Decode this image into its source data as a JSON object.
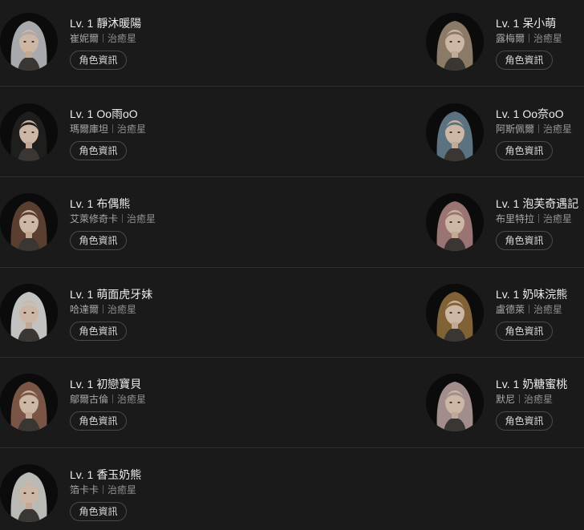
{
  "button_label": "角色資訊",
  "colors": {
    "background": "#1a1a1b",
    "divider": "#2e2e30",
    "title": "#ececec",
    "subtitle": "#a8a8a8"
  },
  "characters": [
    {
      "level": "Lv. 1",
      "name": "靜沐暖陽",
      "char": "崔妮爾",
      "planet": "治癒星",
      "hair": "#a7a9ad"
    },
    {
      "level": "Lv. 1",
      "name": "呆小萌",
      "char": "露梅爾",
      "planet": "治癒星",
      "hair": "#8b7a66"
    },
    {
      "level": "Lv. 1",
      "name": "Oo雨oO",
      "char": "瑪爾庫坦",
      "planet": "治癒星",
      "hair": "#1e1e1c"
    },
    {
      "level": "Lv. 1",
      "name": "Oo奈oO",
      "char": "阿斯佩爾",
      "planet": "治癒星",
      "hair": "#5b7280"
    },
    {
      "level": "Lv. 1",
      "name": "布偶熊",
      "char": "艾萊修奇卡",
      "planet": "治癒星",
      "hair": "#5a3e30"
    },
    {
      "level": "Lv. 1",
      "name": "泡芙奇遇記",
      "char": "布里特拉",
      "planet": "治癒星",
      "hair": "#9a7472"
    },
    {
      "level": "Lv. 1",
      "name": "萌面虎牙妹",
      "char": "哈達爾",
      "planet": "治癒星",
      "hair": "#c2c2c0"
    },
    {
      "level": "Lv. 1",
      "name": "奶味浣熊",
      "char": "盧德萊",
      "planet": "治癒星",
      "hair": "#806236"
    },
    {
      "level": "Lv. 1",
      "name": "初戀寶貝",
      "char": "鄔爾古倫",
      "planet": "治癒星",
      "hair": "#7a5444"
    },
    {
      "level": "Lv. 1",
      "name": "奶糖蜜桃",
      "char": "默尼",
      "planet": "治癒星",
      "hair": "#a08d8c"
    },
    {
      "level": "Lv. 1",
      "name": "香玉奶熊",
      "char": "箔卡卡",
      "planet": "治癒星",
      "hair": "#b9b9b6"
    }
  ]
}
